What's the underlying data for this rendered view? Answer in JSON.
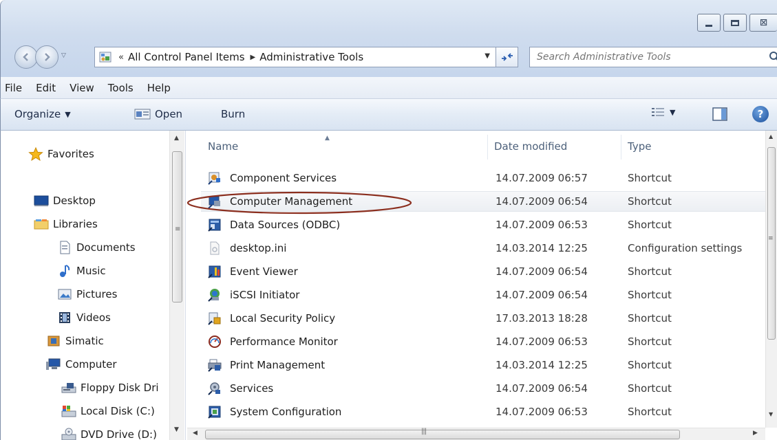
{
  "window": {
    "minimize_icon": "minimize-icon",
    "maximize_icon": "maximize-icon",
    "close_glyph": "⊠"
  },
  "address": {
    "chevrons": "«",
    "crumbs": [
      "All Control Panel Items",
      "Administrative Tools"
    ],
    "separator": "▶"
  },
  "search": {
    "placeholder": "Search Administrative Tools"
  },
  "menu": [
    "File",
    "Edit",
    "View",
    "Tools",
    "Help"
  ],
  "toolbar": {
    "organize": "Organize",
    "open": "Open",
    "burn": "Burn",
    "help": "?"
  },
  "nav": {
    "favorites": "Favorites",
    "desktop": "Desktop",
    "libraries": "Libraries",
    "documents": "Documents",
    "music": "Music",
    "pictures": "Pictures",
    "videos": "Videos",
    "simatic": "Simatic",
    "computer": "Computer",
    "floppy": "Floppy Disk Dri",
    "local_disk": "Local Disk (C:)",
    "dvd": "DVD Drive (D:)"
  },
  "columns": {
    "name": "Name",
    "date": "Date modified",
    "type": "Type"
  },
  "files": [
    {
      "name": "Component Services",
      "date": "14.07.2009 06:57",
      "type": "Shortcut"
    },
    {
      "name": "Computer Management",
      "date": "14.07.2009 06:54",
      "type": "Shortcut"
    },
    {
      "name": "Data Sources (ODBC)",
      "date": "14.07.2009 06:53",
      "type": "Shortcut"
    },
    {
      "name": "desktop.ini",
      "date": "14.03.2014 12:25",
      "type": "Configuration settings"
    },
    {
      "name": "Event Viewer",
      "date": "14.07.2009 06:54",
      "type": "Shortcut"
    },
    {
      "name": "iSCSI Initiator",
      "date": "14.07.2009 06:54",
      "type": "Shortcut"
    },
    {
      "name": "Local Security Policy",
      "date": "17.03.2013 18:28",
      "type": "Shortcut"
    },
    {
      "name": "Performance Monitor",
      "date": "14.07.2009 06:53",
      "type": "Shortcut"
    },
    {
      "name": "Print Management",
      "date": "14.03.2014 12:25",
      "type": "Shortcut"
    },
    {
      "name": "Services",
      "date": "14.07.2009 06:54",
      "type": "Shortcut"
    },
    {
      "name": "System Configuration",
      "date": "14.07.2009 06:53",
      "type": "Shortcut"
    }
  ],
  "colors": {
    "highlight_ellipse": "#8b2e1e",
    "toolbar_text": "#1e2c48",
    "header_text": "#4c607a"
  }
}
